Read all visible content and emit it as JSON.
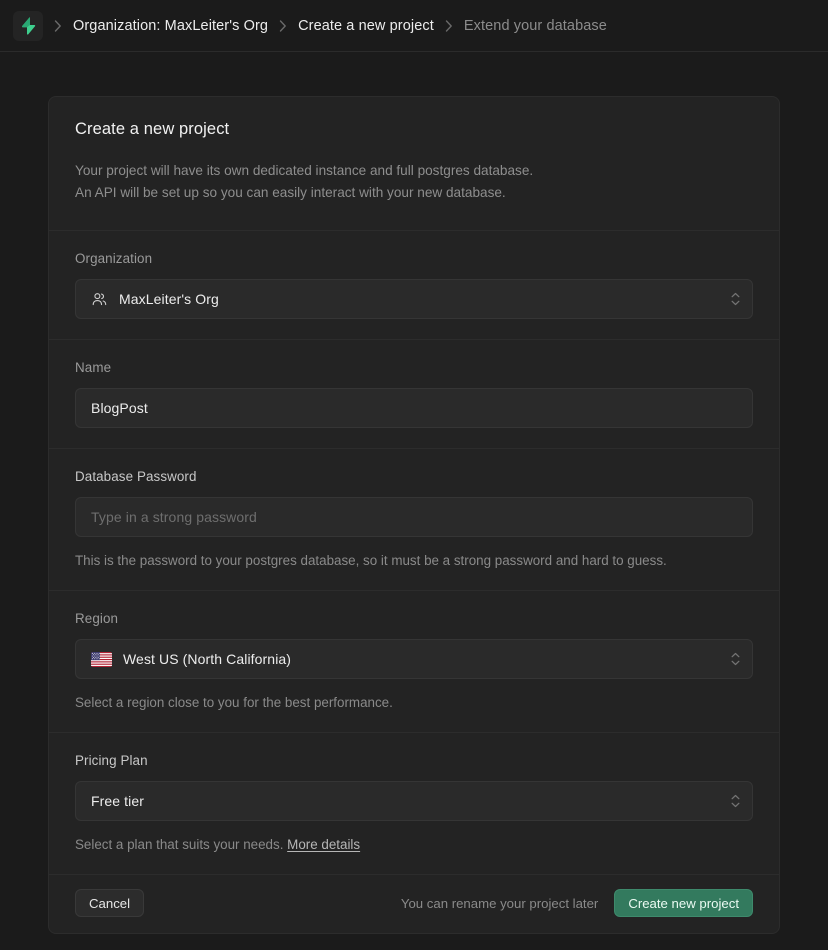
{
  "breadcrumb": {
    "logo_icon": "supabase-bolt-icon",
    "logo_color": "#3ecf8e",
    "separator_icon": "chevron-right-icon",
    "items": [
      {
        "label": "Organization: MaxLeiter's Org",
        "active": true
      },
      {
        "label": "Create a new project",
        "active": true
      },
      {
        "label": "Extend your database",
        "active": false
      }
    ]
  },
  "card": {
    "title": "Create a new project",
    "description_line_1": "Your project will have its own dedicated instance and full postgres database.",
    "description_line_2": "An API will be set up so you can easily interact with your new database."
  },
  "organization": {
    "label": "Organization",
    "icon": "users-icon",
    "value": "MaxLeiter's Org",
    "selector_icon": "chevron-up-down-icon"
  },
  "name": {
    "label": "Name",
    "value": "BlogPost",
    "placeholder": ""
  },
  "password": {
    "label": "Database Password",
    "value": "",
    "placeholder": "Type in a strong password",
    "helper": "This is the password to your postgres database, so it must be a strong password and hard to guess."
  },
  "region": {
    "label": "Region",
    "flag_icon": "flag-us-icon",
    "value": "West US (North California)",
    "selector_icon": "chevron-up-down-icon",
    "helper": "Select a region close to you for the best performance."
  },
  "pricing": {
    "label": "Pricing Plan",
    "value": "Free tier",
    "selector_icon": "chevron-up-down-icon",
    "helper_prefix": "Select a plan that suits your needs.",
    "helper_link": "More details"
  },
  "footer": {
    "cancel_label": "Cancel",
    "hint": "You can rename your project later",
    "submit_label": "Create new project",
    "submit_color": "#337a5e"
  }
}
